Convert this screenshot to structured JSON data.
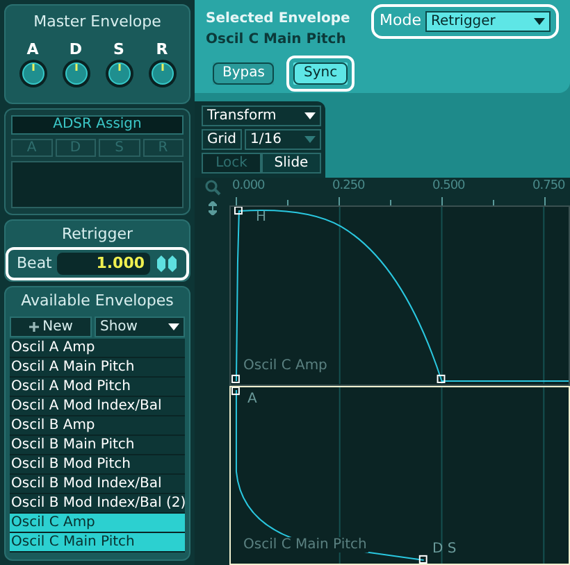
{
  "master_envelope": {
    "title": "Master Envelope",
    "knobs": [
      {
        "label": "A"
      },
      {
        "label": "D"
      },
      {
        "label": "S"
      },
      {
        "label": "R"
      }
    ]
  },
  "adsr_assign": {
    "title": "ADSR Assign",
    "buttons": [
      {
        "label": "A",
        "disabled": true
      },
      {
        "label": "D",
        "disabled": true
      },
      {
        "label": "S",
        "disabled": true
      },
      {
        "label": "R",
        "disabled": true
      }
    ]
  },
  "retrigger": {
    "title": "Retrigger",
    "beat": {
      "label": "Beat",
      "value": "1.000",
      "highlighted": true
    }
  },
  "available_envelopes": {
    "title": "Available Envelopes",
    "new_button": "New",
    "show_dropdown": "Show",
    "items": [
      {
        "label": "Oscil A Amp",
        "selected": false
      },
      {
        "label": "Oscil A Main Pitch",
        "selected": false
      },
      {
        "label": "Oscil A Mod Pitch",
        "selected": false
      },
      {
        "label": "Oscil A Mod Index/Bal",
        "selected": false
      },
      {
        "label": "Oscil B Amp",
        "selected": false
      },
      {
        "label": "Oscil B Main Pitch",
        "selected": false
      },
      {
        "label": "Oscil B Mod Pitch",
        "selected": false
      },
      {
        "label": "Oscil B Mod Index/Bal",
        "selected": false
      },
      {
        "label": "Oscil B Mod Index/Bal (2)",
        "selected": false
      },
      {
        "label": "Oscil C Amp",
        "selected": true
      },
      {
        "label": "Oscil C Main Pitch",
        "selected": true
      }
    ]
  },
  "selected_envelope": {
    "title": "Selected Envelope",
    "name": "Oscil C Main Pitch"
  },
  "mode": {
    "label": "Mode",
    "value": "Retrigger",
    "highlighted": true
  },
  "buttons": [
    {
      "label": "Bypas",
      "on": false,
      "highlighted": false
    },
    {
      "label": "Sync",
      "on": true,
      "highlighted": true
    }
  ],
  "toolbar": {
    "transform": "Transform",
    "grid_label": "Grid",
    "grid_value": "1/16",
    "modes": [
      {
        "label": "Lock",
        "selected": false
      },
      {
        "label": "Slide",
        "selected": true
      }
    ]
  },
  "ruler": [
    "0.000",
    "0.250",
    "0.500",
    "0.750"
  ],
  "lanes": [
    {
      "name": "Oscil C Amp",
      "selected": false,
      "markers": [
        "H"
      ]
    },
    {
      "name": "Oscil C Main Pitch",
      "selected": true,
      "markers": [
        "A",
        "D S"
      ]
    }
  ]
}
